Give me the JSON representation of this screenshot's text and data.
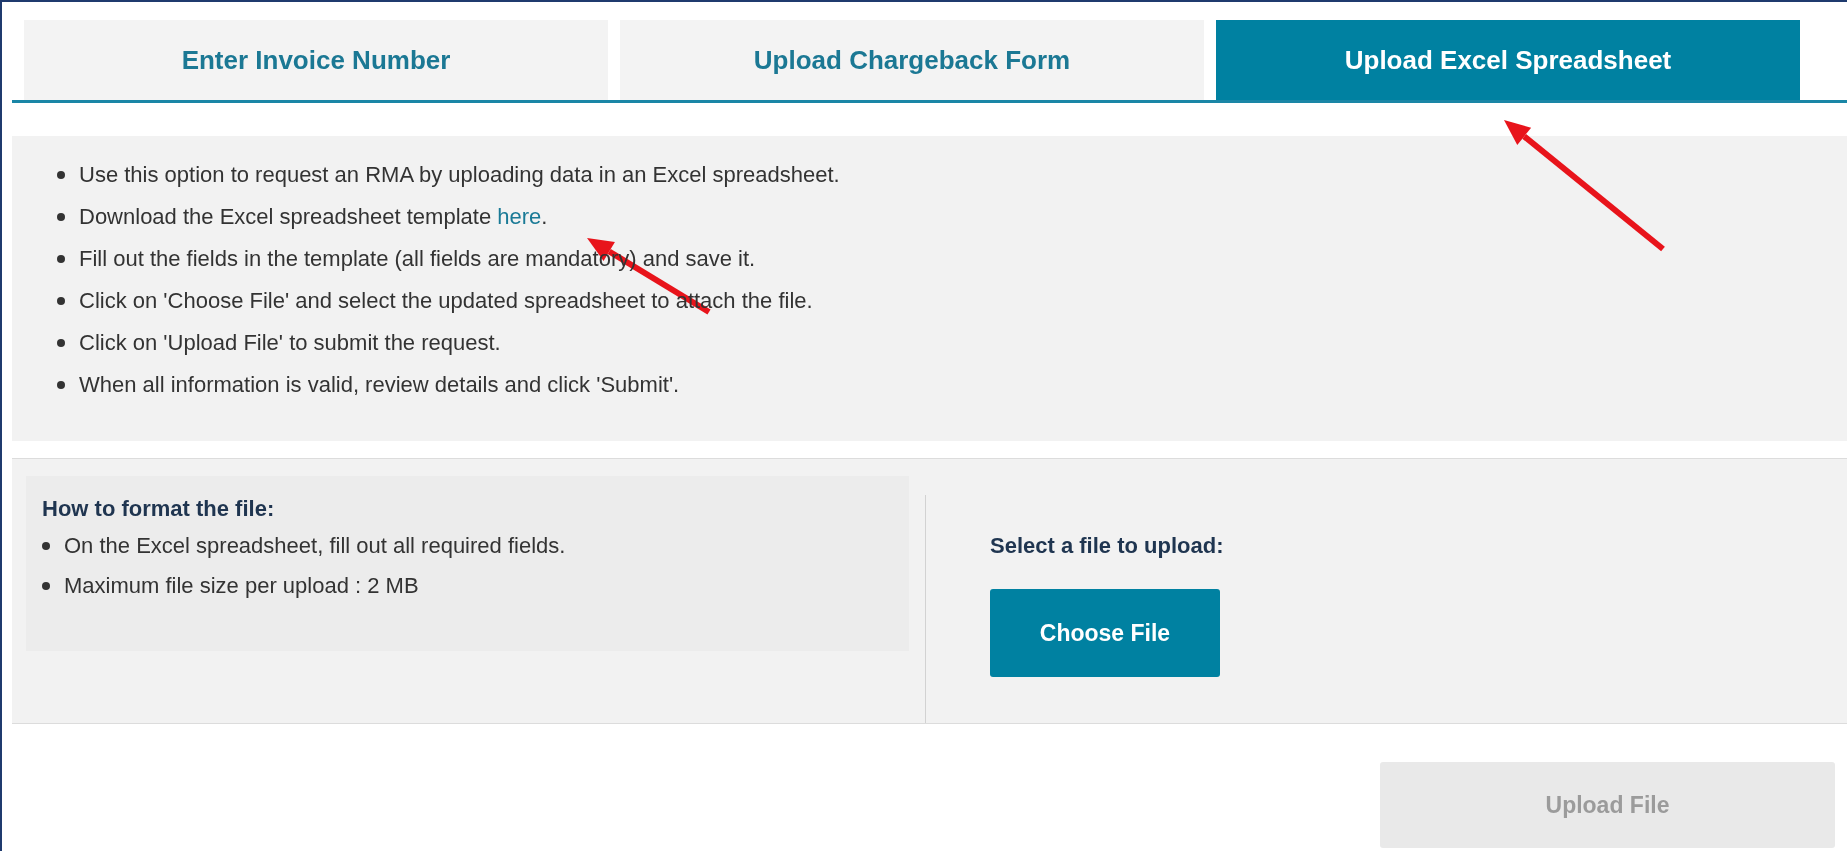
{
  "tabs": [
    {
      "label": "Enter Invoice Number",
      "selected": false
    },
    {
      "label": "Upload Chargeback Form",
      "selected": false
    },
    {
      "label": "Upload Excel Spreadsheet",
      "selected": true
    }
  ],
  "instructions": [
    {
      "text": "Use this option to request an RMA by uploading data in an Excel spreadsheet."
    },
    {
      "text": "Download the Excel spreadsheet template ",
      "link": "here",
      "suffix": "."
    },
    {
      "text": "Fill out the fields in the template (all fields are mandatory) and save it."
    },
    {
      "text": "Click on 'Choose File' and select the updated spreadsheet to attach the file."
    },
    {
      "text": "Click on 'Upload File' to submit the request."
    },
    {
      "text": "When all information is valid, review details and click 'Submit'."
    }
  ],
  "format_panel": {
    "heading": "How to format the file:",
    "items": [
      "On the Excel spreadsheet, fill out all required fields.",
      "Maximum file size per upload : 2 MB"
    ]
  },
  "upload_panel": {
    "label": "Select a file to upload:",
    "choose_button": "Choose File"
  },
  "upload_button": {
    "label": "Upload File",
    "disabled": true
  },
  "annotations": [
    {
      "kind": "arrow"
    },
    {
      "kind": "arrow"
    }
  ]
}
